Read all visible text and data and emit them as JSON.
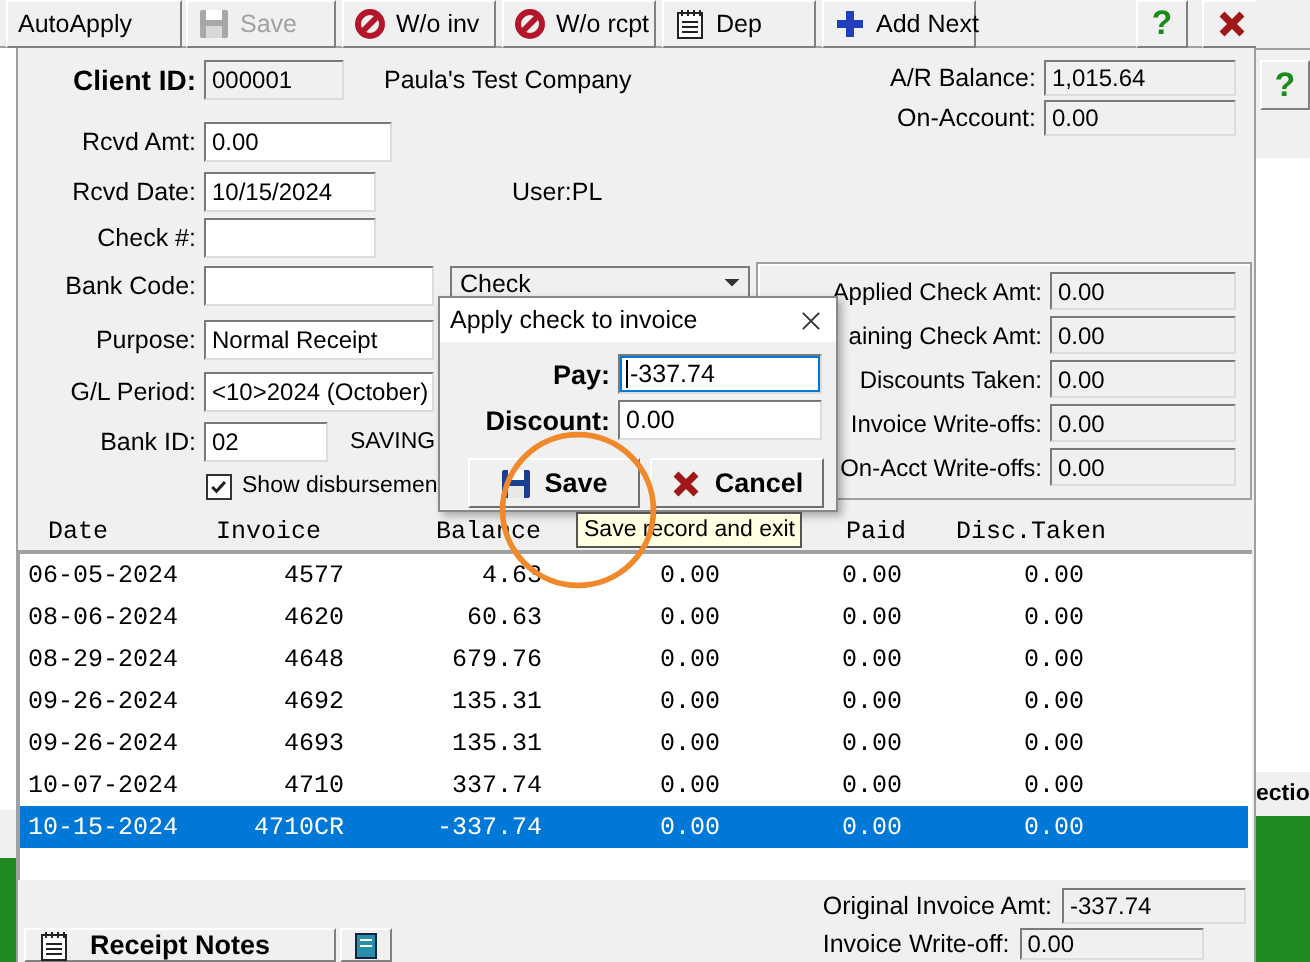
{
  "toolbar": {
    "buttons": [
      {
        "label": "AutoApply",
        "kind": "text",
        "disabled": false
      },
      {
        "label": "Save",
        "kind": "save",
        "disabled": true
      },
      {
        "label": "W/o inv",
        "kind": "writeoff",
        "disabled": false
      },
      {
        "label": "W/o rcpt",
        "kind": "writeoff",
        "disabled": false
      },
      {
        "label": "Dep",
        "kind": "deposit",
        "disabled": false
      },
      {
        "label": "Add Next",
        "kind": "add",
        "disabled": false
      }
    ],
    "help": "?"
  },
  "form": {
    "rows": [
      {
        "label": "Client ID:",
        "value": "000001",
        "kind": "id",
        "note": "Paula's Test Company"
      },
      {
        "label": "Rcvd Amt:",
        "value": "0.00",
        "kind": "input"
      },
      {
        "label": "Rcvd Date:",
        "value": "10/15/2024",
        "kind": "input",
        "note": "User:PL"
      },
      {
        "label": "Check #:",
        "kind": "input"
      },
      {
        "label": "Bank Code:",
        "kind": "input",
        "dropdown": "Check"
      },
      {
        "label": "Purpose:",
        "value": "Normal Receipt",
        "kind": "input"
      },
      {
        "label": "G/L Period:",
        "value": "<10>2024 (October)",
        "kind": "input"
      },
      {
        "label": "Bank ID:",
        "value": "02",
        "kind": "input",
        "note": "SAVING"
      }
    ],
    "checkbox": {
      "label": "Show disbursemen",
      "checked": true
    }
  },
  "balances": [
    {
      "label": "A/R Balance:",
      "value": "1,015.64"
    },
    {
      "label": "On-Account:",
      "value": "0.00"
    }
  ],
  "totals": [
    {
      "label": "Applied Check Amt:",
      "value": "0.00"
    },
    {
      "label": "aining Check Amt:",
      "value": "0.00"
    },
    {
      "label": "Discounts Taken:",
      "value": "0.00"
    },
    {
      "label": "Invoice Write-offs:",
      "value": "0.00"
    },
    {
      "label": "On-Acct Write-offs:",
      "value": "0.00"
    }
  ],
  "table": {
    "columns": {
      "date": "Date",
      "invoice": "Invoice",
      "balance": "Balance",
      "paid": "Paid",
      "disc_taken": "Disc.Taken"
    },
    "rows": [
      {
        "date": "06-05-2024",
        "invoice": "4577",
        "balance": "4.63",
        "column_4": "0.00",
        "paid": "0.00",
        "disc_taken": "0.00",
        "selected": false
      },
      {
        "date": "08-06-2024",
        "invoice": "4620",
        "balance": "60.63",
        "column_4": "0.00",
        "paid": "0.00",
        "disc_taken": "0.00",
        "selected": false
      },
      {
        "date": "08-29-2024",
        "invoice": "4648",
        "balance": "679.76",
        "column_4": "0.00",
        "paid": "0.00",
        "disc_taken": "0.00",
        "selected": false
      },
      {
        "date": "09-26-2024",
        "invoice": "4692",
        "balance": "135.31",
        "column_4": "0.00",
        "paid": "0.00",
        "disc_taken": "0.00",
        "selected": false
      },
      {
        "date": "09-26-2024",
        "invoice": "4693",
        "balance": "135.31",
        "column_4": "0.00",
        "paid": "0.00",
        "disc_taken": "0.00",
        "selected": false
      },
      {
        "date": "10-07-2024",
        "invoice": "4710",
        "balance": "337.74",
        "column_4": "0.00",
        "paid": "0.00",
        "disc_taken": "0.00",
        "selected": false
      },
      {
        "date": "10-15-2024",
        "invoice": "4710CR",
        "balance": "-337.74",
        "column_4": "0.00",
        "paid": "0.00",
        "disc_taken": "0.00",
        "selected": true
      }
    ]
  },
  "footer": {
    "totals": [
      {
        "label": "Original Invoice Amt:",
        "value": "-337.74"
      },
      {
        "label": "Invoice Write-off:",
        "value": "0.00"
      }
    ],
    "notes_button": "Receipt Notes"
  },
  "dialog": {
    "title": "Apply check to invoice",
    "fields": [
      {
        "label": "Pay:",
        "value": "-337.74",
        "focused": true
      },
      {
        "label": "Discount:",
        "value": "0.00",
        "focused": false
      }
    ],
    "buttons": [
      {
        "label": "Save",
        "kind": "save"
      },
      {
        "label": "Cancel",
        "kind": "cancel"
      }
    ]
  },
  "tooltip": "Save record and exit",
  "background_window": {
    "help": "?",
    "fragment": "ectio"
  }
}
